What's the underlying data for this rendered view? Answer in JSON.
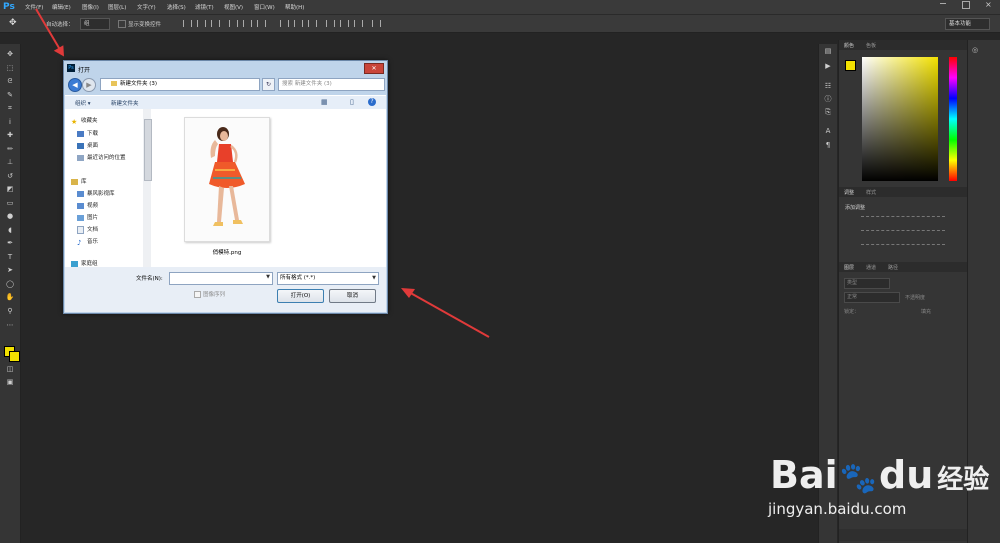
{
  "app": {
    "logo": "Ps",
    "menus": [
      "文件(F)",
      "编辑(E)",
      "图像(I)",
      "图层(L)",
      "文字(Y)",
      "选择(S)",
      "滤镜(T)",
      "视图(V)",
      "窗口(W)",
      "帮助(H)"
    ]
  },
  "options_bar": {
    "auto_select_label": "自动选择：",
    "auto_select_value": "组",
    "show_transform_label": "显示变换控件",
    "workspace": "基本功能"
  },
  "panels": {
    "color_tab": "颜色",
    "swatches_tab": "色板",
    "adjust_tab": "调整",
    "styles_tab": "样式",
    "add_adjustment": "添加调整",
    "layers_tab": "图层",
    "channels_tab": "通道",
    "paths_tab": "路径",
    "kind": "类型",
    "blend_mode": "正常",
    "opacity": "不透明度",
    "lock_label": "锁定：",
    "fill_label": "填充"
  },
  "dialog": {
    "title": "打开",
    "path": "新建文件夹 (3)",
    "search_placeholder": "搜索 新建文件夹 (3)",
    "organize": "组织 ▾",
    "new_folder": "新建文件夹",
    "nav": {
      "favorites": "收藏夹",
      "downloads": "下载",
      "desktop": "桌面",
      "recent": "最近访问的位置",
      "libraries": "库",
      "baofeng": "暴风影视库",
      "videos": "视频",
      "pictures": "图片",
      "documents": "文档",
      "music": "音乐",
      "homegroup": "家庭组"
    },
    "file_name": "俏模特.png",
    "filename_label": "文件名(N):",
    "filename_value": "",
    "format": "所有格式 (*.*)",
    "image_sequence": "图像序列",
    "open_button": "打开(O)",
    "cancel_button": "取消"
  },
  "watermark": {
    "brand_left": "Bai",
    "brand_right": "du",
    "brand_cn": "经验",
    "url": "jingyan.baidu.com"
  },
  "colors": {
    "accent": "#31a8ff",
    "annotation_arrow": "#e03a3a",
    "foreground_swatch": "#f2e100"
  }
}
